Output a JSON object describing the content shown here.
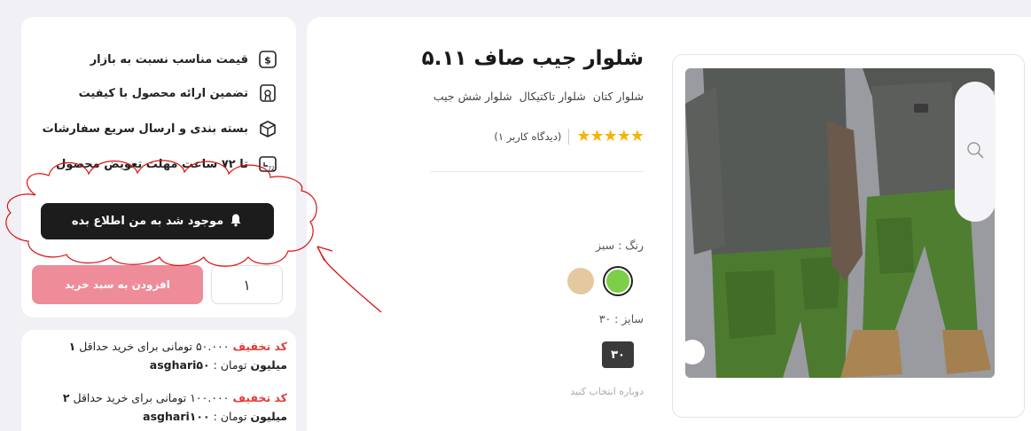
{
  "features": [
    {
      "icon": "dollar-icon",
      "label": "قیمت مناسب نسبت به بازار"
    },
    {
      "icon": "certificate-icon",
      "label": "تضمین ارائه محصول با کیفیت"
    },
    {
      "icon": "package-icon",
      "label": "بسته بندی و ارسال سریع سفارشات"
    },
    {
      "icon": "return-72h-icon",
      "label": "تا ۷۲ ساعت مهلت تعویض محصول"
    }
  ],
  "notify_button": {
    "icon": "bell-icon",
    "label": "موجود شد به من اطلاع بده"
  },
  "add_to_cart": {
    "label": "افزودن به سبد خرید"
  },
  "quantity": {
    "value": "۱"
  },
  "coupons": [
    {
      "tag": "کد تخفیف",
      "text_before": "۵۰.۰۰۰ تومانی برای خرید حداقل",
      "bold_amount": "۱ میلیون",
      "unit": "تومان :",
      "code": "asghari۵۰"
    },
    {
      "tag": "کد تخفیف",
      "text_before": "۱۰۰.۰۰۰ تومانی برای خرید حداقل",
      "bold_amount": "۲ میلیون",
      "unit": "تومان :",
      "code": "asghari۱۰۰"
    }
  ],
  "product": {
    "title": "شلوار جیب صاف ۵.۱۱",
    "tags": [
      "شلوار کتان",
      "شلوار تاکتیکال",
      "شلوار شش جیب"
    ],
    "stars": "★★★★★",
    "rating_value": 5,
    "review_count": "(دیدگاه کاربر ۱)",
    "color_label": "رنگ : سبز",
    "colors": [
      "#7dce48",
      "#e4c9a0"
    ],
    "size_label": "سایز : ۳۰",
    "size_option": "۳۰",
    "reselect": "دوباره انتخاب کنید"
  },
  "gallery": {
    "zoom_icon": "search-icon"
  }
}
